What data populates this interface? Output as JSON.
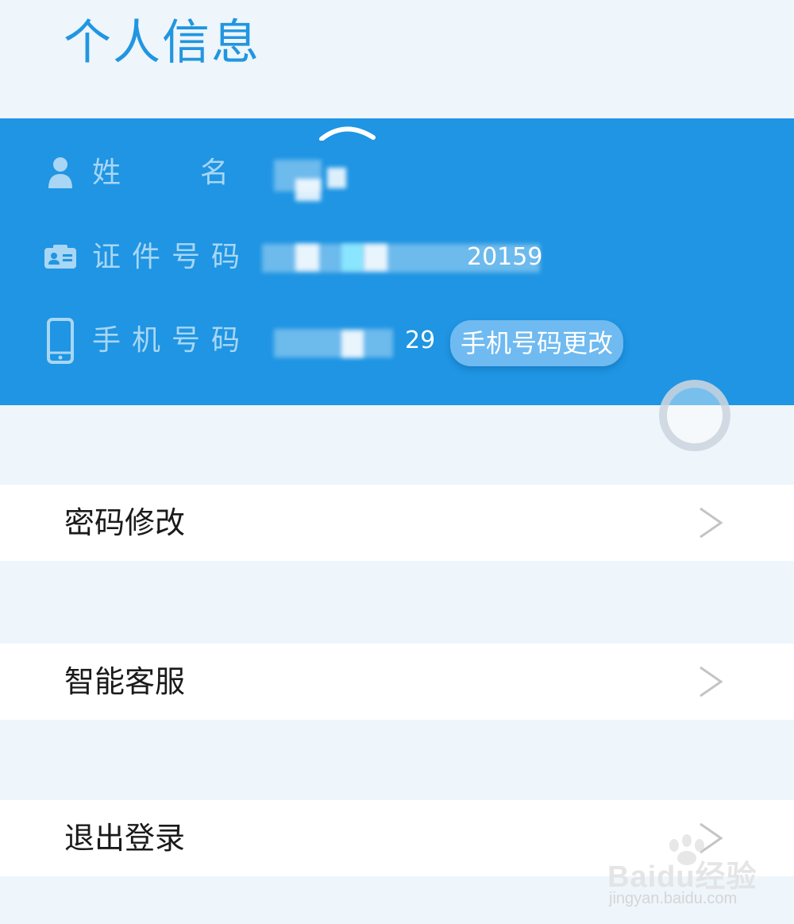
{
  "page": {
    "title": "个人信息"
  },
  "profile": {
    "name_label_1": "姓",
    "name_label_2": "名",
    "id_label": "证件号码",
    "id_value_partial": "20159",
    "phone_label": "手机号码",
    "phone_value_partial": "29",
    "change_phone_button": "手机号码更改"
  },
  "menu": {
    "items": [
      {
        "label": "密码修改"
      },
      {
        "label": "智能客服"
      },
      {
        "label": "退出登录"
      }
    ]
  },
  "watermark": {
    "brand": "Baidu经验",
    "sub": "jingyan.baidu.com"
  },
  "colors": {
    "accent": "#1f95e3",
    "title": "#2196e0",
    "background": "#eef5fb"
  }
}
